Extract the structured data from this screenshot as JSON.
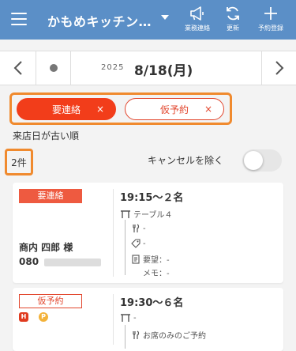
{
  "header": {
    "store_name": "かもめキッチン…",
    "notice_label": "業務連絡",
    "refresh_label": "更新",
    "reserve_label": "予約登録"
  },
  "datebar": {
    "year": "2025",
    "date": "8/18(月)"
  },
  "filters": {
    "urgent_label": "要連絡",
    "tentative_label": "仮予約",
    "close_glyph": "×",
    "sort_label": "来店日が古い順",
    "count": "2件",
    "exclude_cancel_label": "キャンセルを除く",
    "exclude_cancel_on": false
  },
  "reservations": [
    {
      "badge": "要連絡",
      "guest_name": "商内 四郎 様",
      "phone_prefix": "080",
      "time_guests": "19:15～２名",
      "table": "テーブル４",
      "course": "-",
      "tag": "-",
      "request": "要望：-",
      "memo": "メモ：-"
    },
    {
      "badge": "仮予約",
      "icon_h": "H",
      "icon_p": "P",
      "time_guests": "19:30～６名",
      "table": "-",
      "course": "お席のみのご予約"
    }
  ],
  "colors": {
    "header_bg": "#5b8fc7",
    "accent_red": "#f23d1a",
    "highlight_orange": "#f08a2e"
  }
}
